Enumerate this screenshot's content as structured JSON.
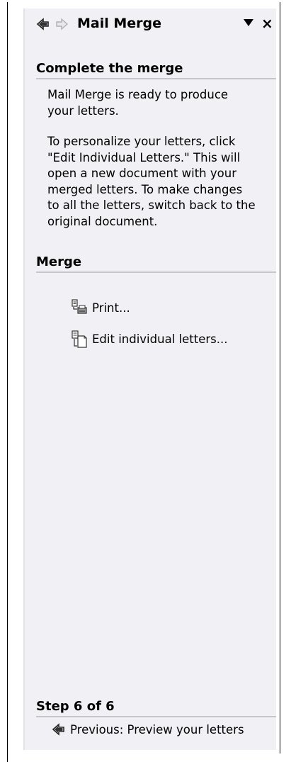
{
  "pane": {
    "title": "Mail Merge",
    "close_glyph": "×",
    "icons": {
      "back": "back-arrow-icon",
      "forward": "forward-arrow-icon",
      "dropdown": "triangle-down-icon",
      "close": "close-icon",
      "print": "print-icon",
      "edit": "edit-letters-icon",
      "previous": "back-arrow-icon"
    }
  },
  "complete": {
    "header": "Complete the merge",
    "para1_line1": "Mail Merge is ready to produce",
    "para1_line2": "your letters.",
    "para2_line1": "To personalize your letters, click",
    "para2_line2": "\"Edit Individual Letters.\" This will",
    "para2_line3": "open a new document with your",
    "para2_line4": "merged letters. To make changes",
    "para2_line5": "to all the letters, switch back to the",
    "para2_line6": "original document."
  },
  "merge": {
    "header": "Merge",
    "print_label": "Print...",
    "edit_label": "Edit individual letters..."
  },
  "step": {
    "header": "Step 6 of 6",
    "previous_label": "Previous: Preview your letters"
  }
}
